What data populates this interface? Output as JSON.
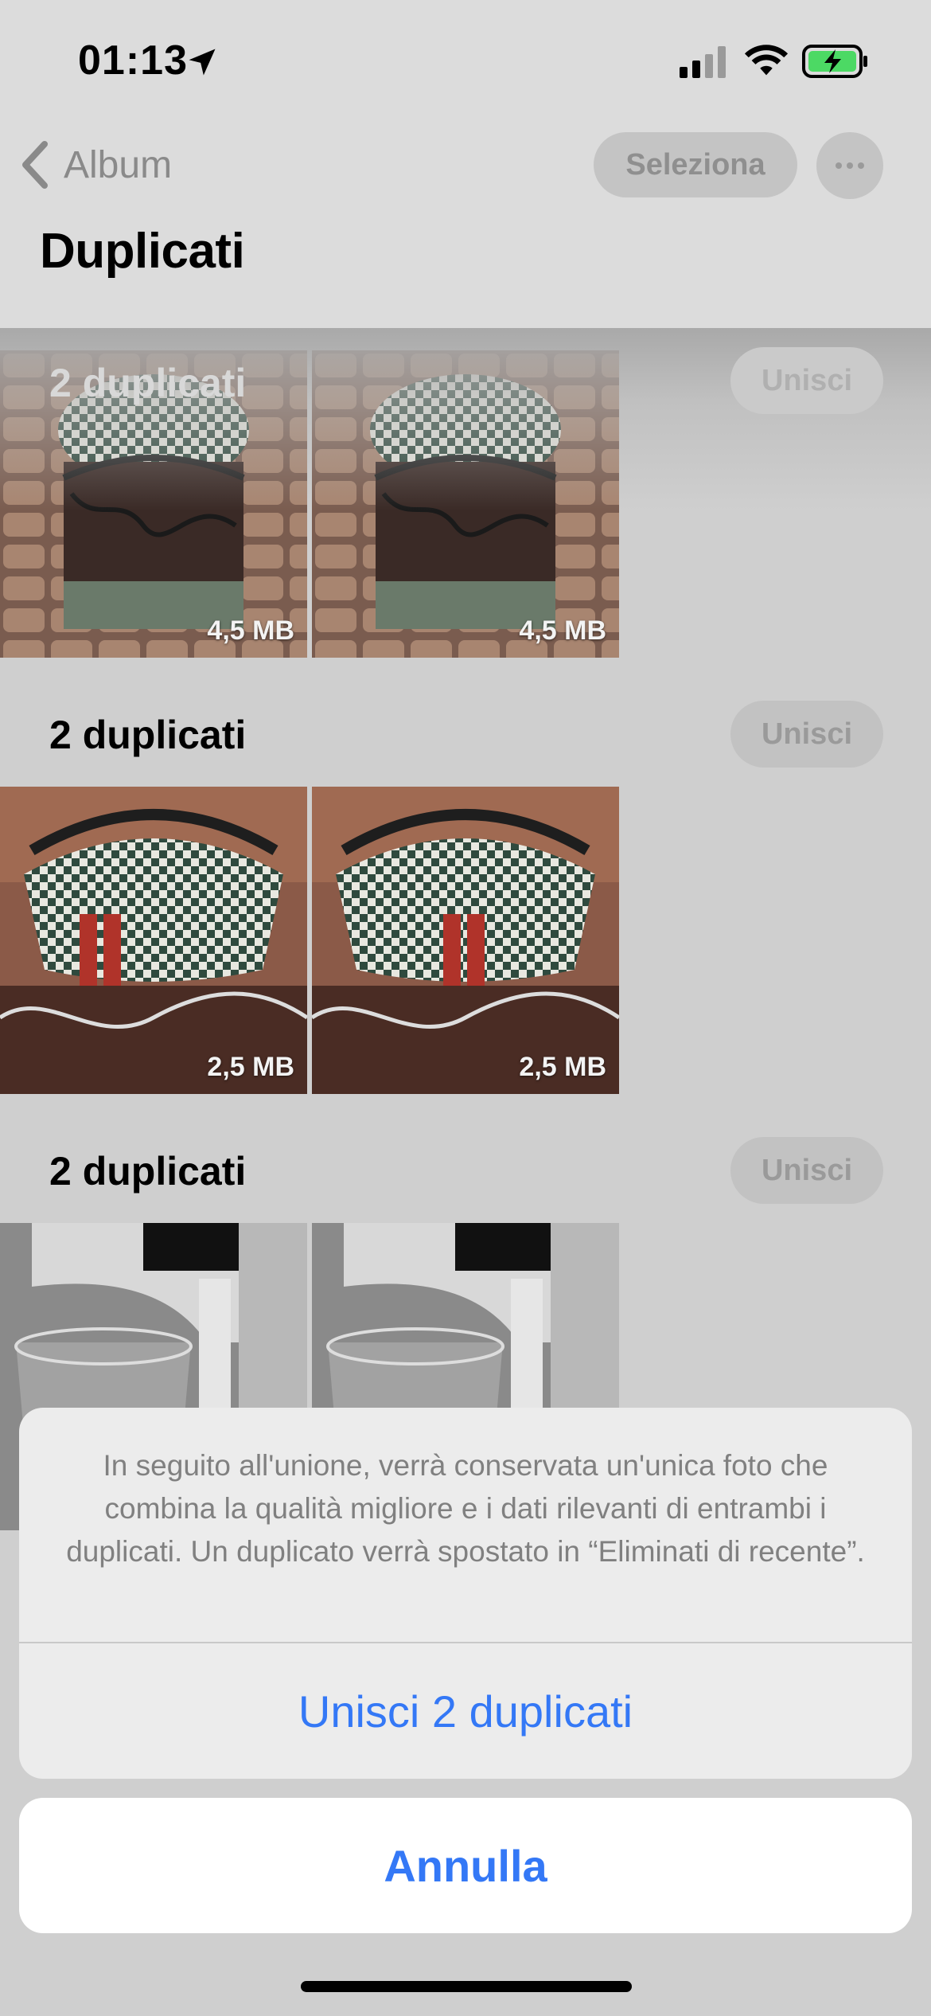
{
  "status_bar": {
    "time": "01:13",
    "location_icon": "location-arrow-icon",
    "signal_icon": "cellular-signal-icon",
    "wifi_icon": "wifi-icon",
    "battery_icon": "battery-charging-icon",
    "battery_color": "#4cd964"
  },
  "nav": {
    "back_label": "Album",
    "select_label": "Seleziona",
    "more_icon": "ellipsis-icon"
  },
  "page": {
    "title": "Duplicati"
  },
  "groups": [
    {
      "title": "2 duplicati",
      "merge_label": "Unisci",
      "photos": [
        {
          "size": "4,5 MB"
        },
        {
          "size": "4,5 MB"
        }
      ]
    },
    {
      "title": "2 duplicati",
      "merge_label": "Unisci",
      "photos": [
        {
          "size": "2,5 MB"
        },
        {
          "size": "2,5 MB"
        }
      ]
    },
    {
      "title": "2 duplicati",
      "merge_label": "Unisci",
      "photos": [
        {
          "size": ""
        },
        {
          "size": ""
        }
      ]
    }
  ],
  "action_sheet": {
    "message": "In seguito all'unione, verrà conservata un'unica foto che combina la qualità migliore e i dati rilevanti di entrambi i duplicati. Un duplicato verrà spostato in “Eliminati di recente”.",
    "action_label": "Unisci 2 duplicati",
    "cancel_label": "Annulla"
  },
  "colors": {
    "accent": "#3478f6",
    "dim_overlay": "#cfcfcf"
  }
}
